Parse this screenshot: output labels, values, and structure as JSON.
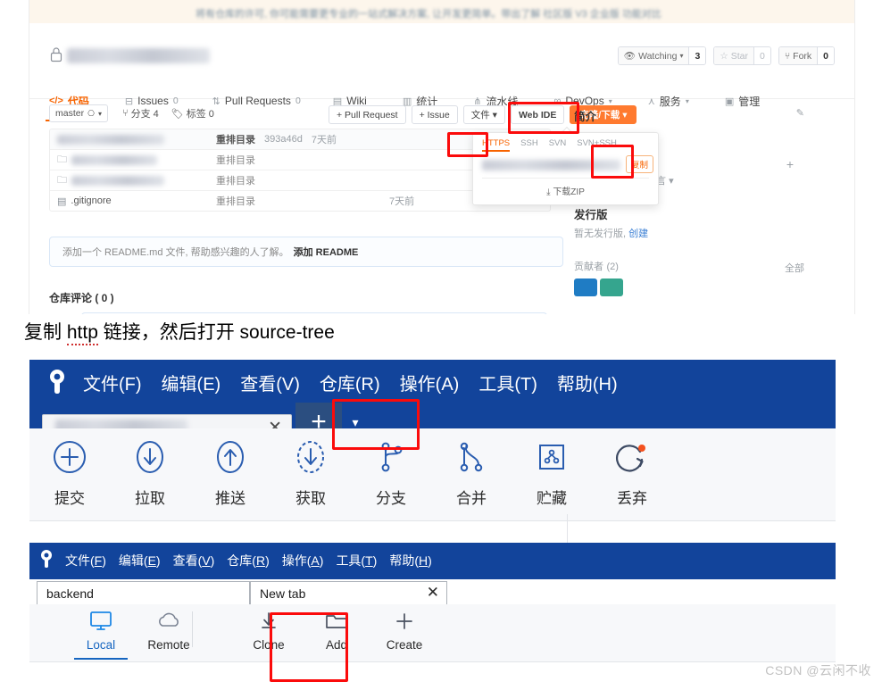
{
  "gitee": {
    "banner_text": "将有仓库的许可, 你可能需要更专业的一站式解决方案, 让开发更简单。带出了解 社区版 V3 企业版 功能对比",
    "repo_name_redacted": "",
    "actions": [
      {
        "icon": "eye-icon",
        "label": "Watching",
        "count": "3",
        "dim": false,
        "caret": true
      },
      {
        "icon": "star-icon",
        "label": "Star",
        "count": "0",
        "dim": true,
        "caret": false
      },
      {
        "icon": "fork-icon",
        "label": "Fork",
        "count": "0",
        "dim": false,
        "caret": false
      }
    ],
    "tabs": [
      {
        "icon": "code-icon",
        "label": "代码",
        "badge": "",
        "active": true,
        "caret": false
      },
      {
        "icon": "issues-icon",
        "label": "Issues",
        "badge": "0",
        "active": false,
        "caret": false
      },
      {
        "icon": "pull-request-icon",
        "label": "Pull Requests",
        "badge": "0",
        "active": false,
        "caret": false
      },
      {
        "icon": "wiki-icon",
        "label": "Wiki",
        "badge": "",
        "active": false,
        "caret": false
      },
      {
        "icon": "stats-icon",
        "label": "统计",
        "badge": "",
        "active": false,
        "caret": false
      },
      {
        "icon": "pipeline-icon",
        "label": "流水线",
        "badge": "",
        "active": false,
        "caret": false
      },
      {
        "icon": "devops-icon",
        "label": "DevOps",
        "badge": "",
        "active": false,
        "caret": true
      },
      {
        "icon": "service-icon",
        "label": "服务",
        "badge": "",
        "active": false,
        "caret": true
      },
      {
        "icon": "manage-icon",
        "label": "管理",
        "badge": "",
        "active": false,
        "caret": false
      }
    ],
    "branch_selector": "master",
    "branch_count_label": "分支 4",
    "tag_count_label": "标签 0",
    "sub_buttons": [
      {
        "label": "+ Pull Request",
        "style": "default"
      },
      {
        "label": "+ Issue",
        "style": "default"
      },
      {
        "label": "文件 ▾",
        "style": "default"
      },
      {
        "label": "Web IDE",
        "style": "bold"
      },
      {
        "label": "克隆/下载 ▾",
        "style": "primary"
      }
    ],
    "files": {
      "head": {
        "msg": "重排目录",
        "sha": "393a46d",
        "time": "7天前"
      },
      "rows": [
        {
          "name": "",
          "redacted": true,
          "msg": "重排目录",
          "time": ""
        },
        {
          "name": "",
          "redacted": true,
          "msg": "重排目录",
          "time": ""
        },
        {
          "name": ".gitignore",
          "redacted": false,
          "msg": "重排目录",
          "time": "7天前"
        }
      ]
    },
    "readme_prompt": "添加一个 README.md 文件, 帮助感兴趣的人了解。",
    "readme_link": "添加 README",
    "repo_comment_title": "仓库评论 ( 0 )",
    "sidebar": {
      "intro_title": "简介",
      "lang_label": "种语言",
      "release_title": "发行版",
      "release_empty": "暂无发行版,",
      "release_create": "创建",
      "contributors_title": "贡献者",
      "contributors_count": "(2)",
      "contributors_all": "全部"
    },
    "clone_popover": {
      "tabs": [
        "HTTPS",
        "SSH",
        "SVN",
        "SVN+SSH"
      ],
      "active_tab": "HTTPS",
      "url_redacted": "",
      "copy_label": "复制",
      "zip_label": "下载ZIP"
    },
    "accent_color": "#f76300",
    "primary_button_color": "#ff7a2f"
  },
  "annotation": {
    "prefix": "复制 ",
    "underlined": "http",
    "suffix": " 链接，然后打开 source-tree"
  },
  "sourcetree_a": {
    "app_icon": "sourcetree-logo-icon",
    "menu": [
      "文件(F)",
      "编辑(E)",
      "查看(V)",
      "仓库(R)",
      "操作(A)",
      "工具(T)",
      "帮助(H)"
    ],
    "tab_title_redacted": "",
    "tab_close_label": "✕",
    "new_tab_plus": "+",
    "new_tab_caret": "▾",
    "toolbar": [
      {
        "icon": "commit-icon",
        "label": "提交"
      },
      {
        "icon": "pull-icon",
        "label": "拉取"
      },
      {
        "icon": "push-icon",
        "label": "推送"
      },
      {
        "icon": "fetch-icon",
        "label": "获取"
      },
      {
        "icon": "branch-icon",
        "label": "分支"
      },
      {
        "icon": "merge-icon",
        "label": "合并"
      },
      {
        "icon": "stash-icon",
        "label": "贮藏"
      },
      {
        "icon": "discard-icon",
        "label": "丢弃"
      }
    ],
    "titlebar_color": "#12449b"
  },
  "sourcetree_b": {
    "app_icon": "sourcetree-logo-icon",
    "menu": [
      {
        "text": "文件(",
        "key": "F",
        "close": ")"
      },
      {
        "text": "编辑(",
        "key": "E",
        "close": ")"
      },
      {
        "text": "查看(",
        "key": "V",
        "close": ")"
      },
      {
        "text": "仓库(",
        "key": "R",
        "close": ")"
      },
      {
        "text": "操作(",
        "key": "A",
        "close": ")"
      },
      {
        "text": "工具(",
        "key": "T",
        "close": ")"
      },
      {
        "text": "帮助(",
        "key": "H",
        "close": ")"
      }
    ],
    "tabs": [
      {
        "label": "backend",
        "closable": false,
        "active": false
      },
      {
        "label": "New tab",
        "closable": true,
        "active": true
      }
    ],
    "tab_close_label": "✕",
    "new_tab_plus": "+",
    "new_tab_caret": "▾",
    "toolbar": [
      {
        "icon": "monitor-icon",
        "label": "Local",
        "active": true
      },
      {
        "icon": "cloud-icon",
        "label": "Remote",
        "active": false
      },
      {
        "icon": "clone-download-icon",
        "label": "Clone",
        "active": false
      },
      {
        "icon": "folder-icon",
        "label": "Add",
        "active": false
      },
      {
        "icon": "plus-icon",
        "label": "Create",
        "active": false
      }
    ],
    "titlebar_color": "#12449b",
    "active_color": "#1565c0"
  },
  "watermark": "CSDN @云闲不收",
  "highlight_color": "#fb0b0b"
}
